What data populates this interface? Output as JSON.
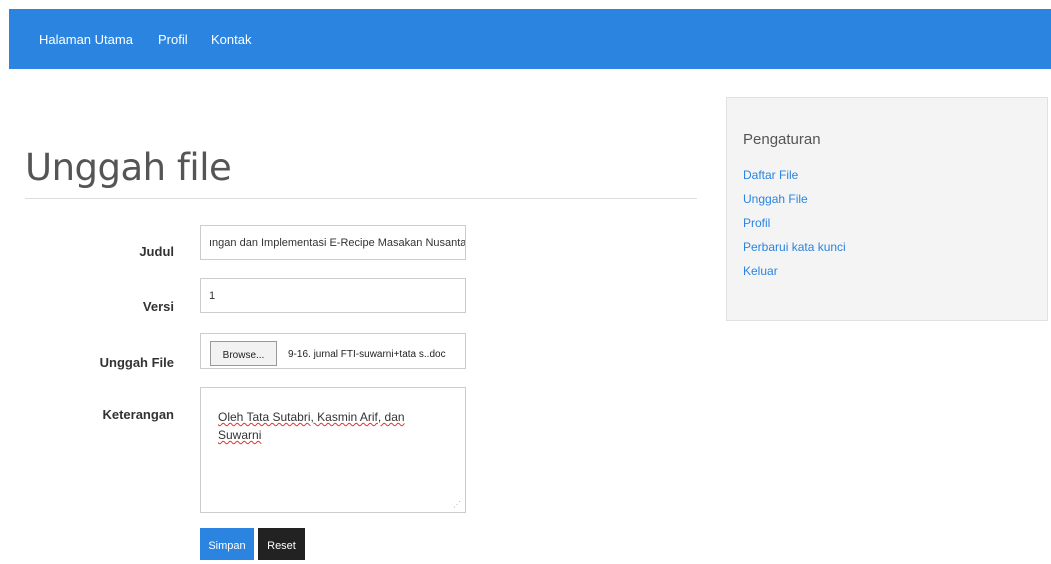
{
  "nav": {
    "items": [
      {
        "label": "Halaman Utama"
      },
      {
        "label": "Profil"
      },
      {
        "label": "Kontak"
      }
    ]
  },
  "page": {
    "title": "Unggah file"
  },
  "form": {
    "judul_label": "Judul",
    "judul_value": "ıngan dan Implementasi E-Recipe Masakan Nusantara",
    "versi_label": "Versi",
    "versi_value": "1",
    "file_label": "Unggah File",
    "browse_label": "Browse...",
    "file_name": "9-16. jurnal FTI-suwarni+tata s..doc",
    "keterangan_label": "Keterangan",
    "keterangan_value": "Oleh Tata Sutabri, Kasmin Arif, dan Suwarni",
    "save_label": "Simpan",
    "reset_label": "Reset"
  },
  "sidebar": {
    "title": "Pengaturan",
    "items": [
      {
        "label": "Daftar File"
      },
      {
        "label": "Unggah File"
      },
      {
        "label": "Profil"
      },
      {
        "label": "Perbarui kata kunci"
      },
      {
        "label": "Keluar"
      }
    ]
  },
  "colors": {
    "navbar": "#2a84e0",
    "link": "#2a84e0",
    "save_button": "#2a84e0",
    "reset_button": "#222222",
    "sidebar_bg": "#f4f4f4"
  }
}
